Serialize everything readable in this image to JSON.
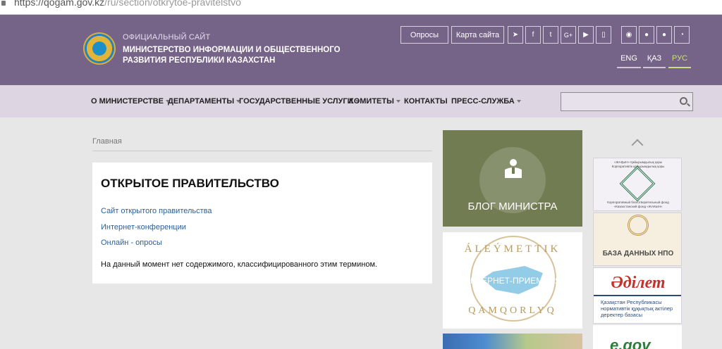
{
  "browser": {
    "url_host": "https://qogam.gov.kz",
    "url_path": "/ru/section/otkrytoe-pravitelstvo"
  },
  "header": {
    "kicker": "ОФИЦИАЛЬНЫЙ САЙТ",
    "name_line1": "МИНИСТЕРСТВО ИНФОРМАЦИИ И ОБЩЕСТВЕННОГО",
    "name_line2": "РАЗВИТИЯ РЕСПУБЛИКИ КАЗАХСТАН",
    "buttons": {
      "surveys": "Опросы",
      "sitemap": "Карта сайта"
    },
    "social": [
      "telegram-icon",
      "facebook-icon",
      "twitter-icon",
      "google-plus-icon",
      "youtube-icon",
      "mobile-icon"
    ],
    "tools": [
      "eye-icon",
      "android-icon",
      "apple-icon",
      "rss-icon"
    ],
    "social_glyphs": {
      "telegram": "➤",
      "facebook": "f",
      "twitter": "t",
      "google": "G+",
      "youtube": "▶",
      "mobile": "▯"
    },
    "tool_glyphs": {
      "eye": "◉",
      "android": "●",
      "apple": "●",
      "rss": "◔"
    },
    "languages": {
      "eng": "ENG",
      "kaz": "ҚАЗ",
      "rus": "РУС",
      "active": "РУС"
    }
  },
  "nav": {
    "items": [
      {
        "label": "О МИНИСТЕРСТВЕ",
        "dropdown": true
      },
      {
        "label": "ДЕПАРТАМЕНТЫ",
        "dropdown": true
      },
      {
        "label": "ГОСУДАРСТВЕННЫЕ УСЛУГИ",
        "dropdown": true
      },
      {
        "label": "КОМИТЕТЫ",
        "dropdown": true
      },
      {
        "label": "КОНТАКТЫ",
        "dropdown": false
      },
      {
        "label": "ПРЕСС-СЛУЖБА",
        "dropdown": true
      }
    ],
    "search": {
      "value": "",
      "placeholder": ""
    }
  },
  "breadcrumb": {
    "home": "Главная"
  },
  "content": {
    "title": "ОТКРЫТОЕ ПРАВИТЕЛЬСТВО",
    "links": [
      "Сайт открытого правительства",
      "Интернет-конференции",
      "Онлайн - опросы"
    ],
    "message": "На данный момент нет содержимого, классифицированного этим термином."
  },
  "banners": {
    "blog": "БЛОГ МИНИСТРА",
    "aleumettik_top": "ÁLEÝMETTIK",
    "aleumettik_bottom": "QAMQORLYQ",
    "aleumettik_overlay": "ИНТЕРНЕТ-ПРИЕМНАЯ"
  },
  "sidebar": {
    "fund_line1": "«ЖАҚЫН» Қайырымдылық қоры",
    "fund_line2": "Корпоративтік қайырымдылық қоры",
    "fund_caption1": "Корпоративный благотворительный фонд",
    "fund_caption2": "«Казахстанский фонд «ЖАКЫН»",
    "ngo_db": "БАЗА ДАННЫХ НПО",
    "adilet_logo": "Әділет",
    "adilet_caption": "Қазақстан Республикасы нормативтік құқықтық актілер деректер базасы",
    "egov_logo": "e.gov"
  },
  "colors": {
    "header": "#766388",
    "nav": "#ddd5e2",
    "page": "#e7e7e7",
    "blog": "#727c52",
    "active_lang": "#c9e07a"
  }
}
